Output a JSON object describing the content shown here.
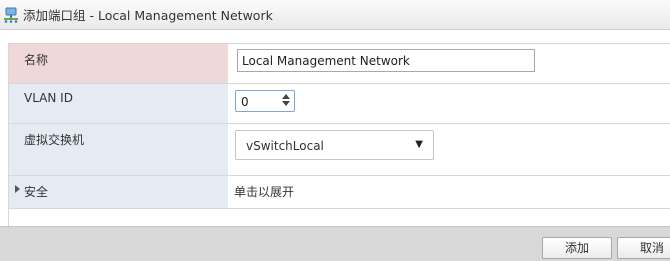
{
  "window": {
    "title": "添加端口组 - Local Management Network"
  },
  "form": {
    "rows": [
      {
        "label": "名称",
        "value": "Local Management Network"
      },
      {
        "label": "VLAN ID",
        "value": "0"
      },
      {
        "label": "虚拟交换机",
        "value": "vSwitchLocal"
      },
      {
        "label": "安全",
        "value": "单击以展开"
      }
    ]
  },
  "footer": {
    "add_label": "添加",
    "cancel_label": "取消"
  },
  "colors": {
    "error_row": "#f0d8d8",
    "label_bg": "#e4ebf3",
    "footer_bg": "#d8d8d8"
  }
}
